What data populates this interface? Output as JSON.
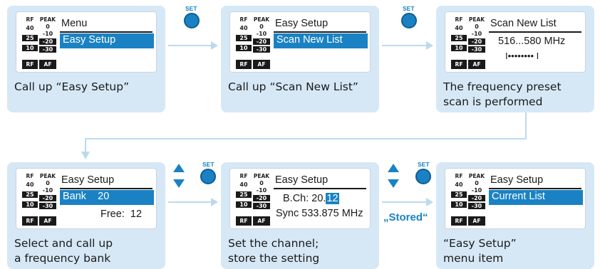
{
  "colors": {
    "accent": "#1a82c4",
    "panel": "#d6e8f6",
    "arrow": "#bcd9ee"
  },
  "meter": {
    "rf_top": "RF",
    "af_top": "PEAK",
    "rf_nums": [
      "40",
      "25",
      "10"
    ],
    "af_nums": [
      "0",
      "-10",
      "-20",
      "-30"
    ],
    "rf_label": "RF",
    "af_label": "AF"
  },
  "controls": {
    "set_label": "SET",
    "stored_label": "„Stored“"
  },
  "steps": [
    {
      "title": "Menu",
      "selected": "Easy Setup",
      "caption": "Call up “Easy Setup”"
    },
    {
      "title": "Easy Setup",
      "selected": "Scan New List",
      "caption": "Call up “Scan New List”"
    },
    {
      "title": "Scan New List",
      "line1": "516...580 MHz",
      "progress_glyph": "I•••••••• I",
      "caption": "The frequency preset\nscan is performed"
    },
    {
      "title": "Easy Setup",
      "selected": "Bank    20",
      "line1": "Free:  12",
      "caption": "Select and call up\na frequency bank"
    },
    {
      "title": "Easy Setup",
      "line1_prefix": "B.Ch: 20.",
      "line1_highlight": "12",
      "line2": "Sync 533.875 MHz",
      "caption": "Set the channel;\nstore the setting"
    },
    {
      "title": "Easy Setup",
      "selected": "Current List",
      "caption": "“Easy Setup”\nmenu item"
    }
  ]
}
